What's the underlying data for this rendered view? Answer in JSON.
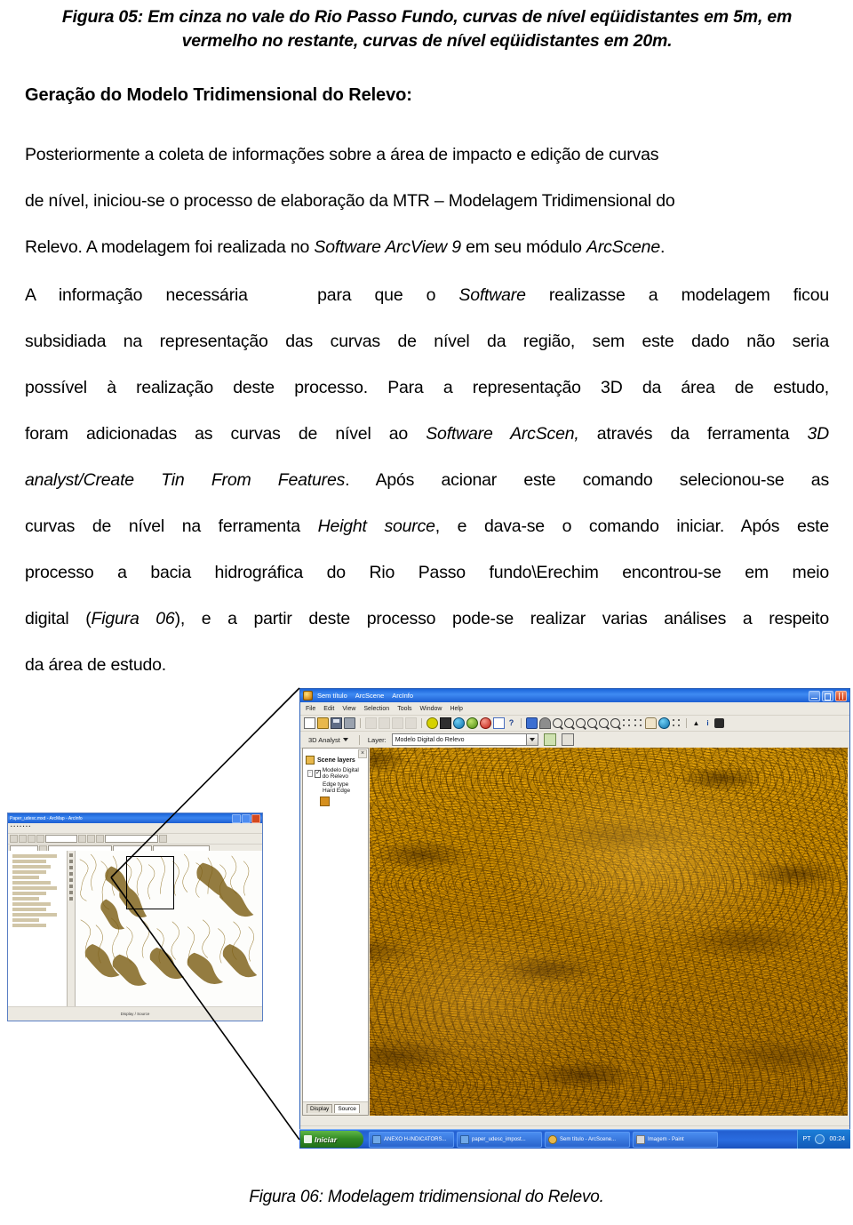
{
  "document": {
    "figure05_caption": "Figura 05: Em cinza no vale do Rio Passo Fundo, curvas de nível eqüidistantes em 5m, em vermelho no restante, curvas de nível eqüidistantes em 20m.",
    "figure05_caption_line1": "Figura 05: Em cinza no vale do Rio Passo Fundo, curvas de nível eqüidistantes em 5m, em",
    "figure05_caption_line2": "vermelho no restante, curvas de nível eqüidistantes em 20m.",
    "section_heading": "Geração do Modelo Tridimensional do Relevo:",
    "paragraph1": {
      "line1": "Posteriormente a coleta de informações sobre a área de impacto e edição de curvas",
      "line2": "de nível, iniciou-se o processo de elaboração da MTR – Modelagem Tridimensional do",
      "line3_a": "Relevo. A modelagem foi realizada no ",
      "line3_italic": "Software ArcView 9",
      "line3_b": " em seu módulo ",
      "line3_italic2": "ArcScene",
      "line3_c": "."
    },
    "paragraph2": {
      "line1_a": "A informação necessária   para que o ",
      "line1_italic": "Software",
      "line1_b": " realizasse a modelagem ficou",
      "line2": "subsidiada na representação das curvas de nível da região, sem este dado não seria",
      "line3": "possível à realização deste processo. Para a representação 3D da área de estudo,",
      "line4_a": "foram adicionadas as curvas de nível ao ",
      "line4_italic": "Software ArcScen,",
      "line4_b": " através da ferramenta ",
      "line4_italic2": "3D",
      "line5_italic": "analyst/Create Tin From Features",
      "line5_b": ". Após acionar este comando selecionou-se as",
      "line6_a": "curvas de nível na ferramenta ",
      "line6_italic": "Height source",
      "line6_b": ", e dava-se o comando iniciar. Após este",
      "line7": "processo a bacia hidrográfica do Rio Passo fundo\\Erechim encontrou-se em meio",
      "line8_a": "digital (",
      "line8_italic": "Figura 06",
      "line8_b": "), e a partir deste processo pode-se realizar varias análises a respeito",
      "line9": "da área de estudo."
    },
    "figure06_caption": "Figura 06: Modelagem tridimensional do Relevo."
  },
  "screenshot": {
    "arcscene_window": {
      "title": "Sem título - ArcScene - ArcInfo",
      "title_parts": [
        "Sem título",
        "ArcScene",
        "ArcInfo"
      ],
      "window_controls": {
        "minimize": "–",
        "maximize": "□",
        "close": "×"
      },
      "menu": [
        "File",
        "Edit",
        "View",
        "Selection",
        "Tools",
        "Window",
        "Help"
      ],
      "toolbar_icons": [
        "new-document-icon",
        "open-folder-icon",
        "save-icon",
        "print-icon",
        "cut-icon",
        "copy-icon",
        "paste-icon",
        "delete-icon",
        "add-data-icon",
        "grid-icon",
        "globe-icon",
        "scene-properties-icon",
        "target-icon",
        "rectangle-icon",
        "context-help-icon",
        "navigate-icon",
        "fly-icon",
        "zoom-in-out-icon",
        "pan-icon",
        "zoom-in-icon",
        "zoom-out-icon",
        "zoom-center-icon",
        "zoom-target-icon",
        "full-extent-icon",
        "zoom-to-layer-icon",
        "grab-hand-icon",
        "globe-rotate-icon",
        "select-features-icon",
        "select-arrow-icon",
        "identify-icon",
        "find-icon"
      ],
      "analyst_toolbar": {
        "menu_label": "3D Analyst",
        "layer_label": "Layer:",
        "layer_value": "Modelo Digital do Relevo",
        "tool_icons": [
          "create-tin-icon",
          "interpolate-icon"
        ]
      },
      "toc": {
        "title": "Scene layers",
        "close_button": "×",
        "layer": "Modelo Digital do Relevo",
        "layer_checked": true,
        "sub_items": [
          "Edge type",
          "Hard Edge"
        ],
        "symbol_color": "#d58f1e",
        "tabs": [
          "Display",
          "Source"
        ],
        "active_tab": "Source"
      },
      "canvas": {
        "content": "3D terrain model / digital elevation model",
        "base_color": "#c28c12",
        "shadow_color": "#3c2805"
      }
    },
    "arcmap_window": {
      "title": "Paper_udesc.mxd - ArcMap - ArcInfo",
      "callout_label": "zoom-region-box",
      "status_text": "Display / Source"
    },
    "taskbar": {
      "start_label": "Iniciar",
      "items": [
        {
          "label": "ANEXO H-INDICATORS...",
          "icon": "word-document-icon"
        },
        {
          "label": "paper_udesc_impost...",
          "icon": "word-document-icon"
        },
        {
          "label": "Sem título - ArcScene...",
          "icon": "arcscene-icon"
        },
        {
          "label": "Imagem - Paint",
          "icon": "paint-icon"
        }
      ],
      "tray": {
        "language": "PT",
        "volume_icon": "speaker-icon",
        "clock": "00:24"
      }
    }
  }
}
